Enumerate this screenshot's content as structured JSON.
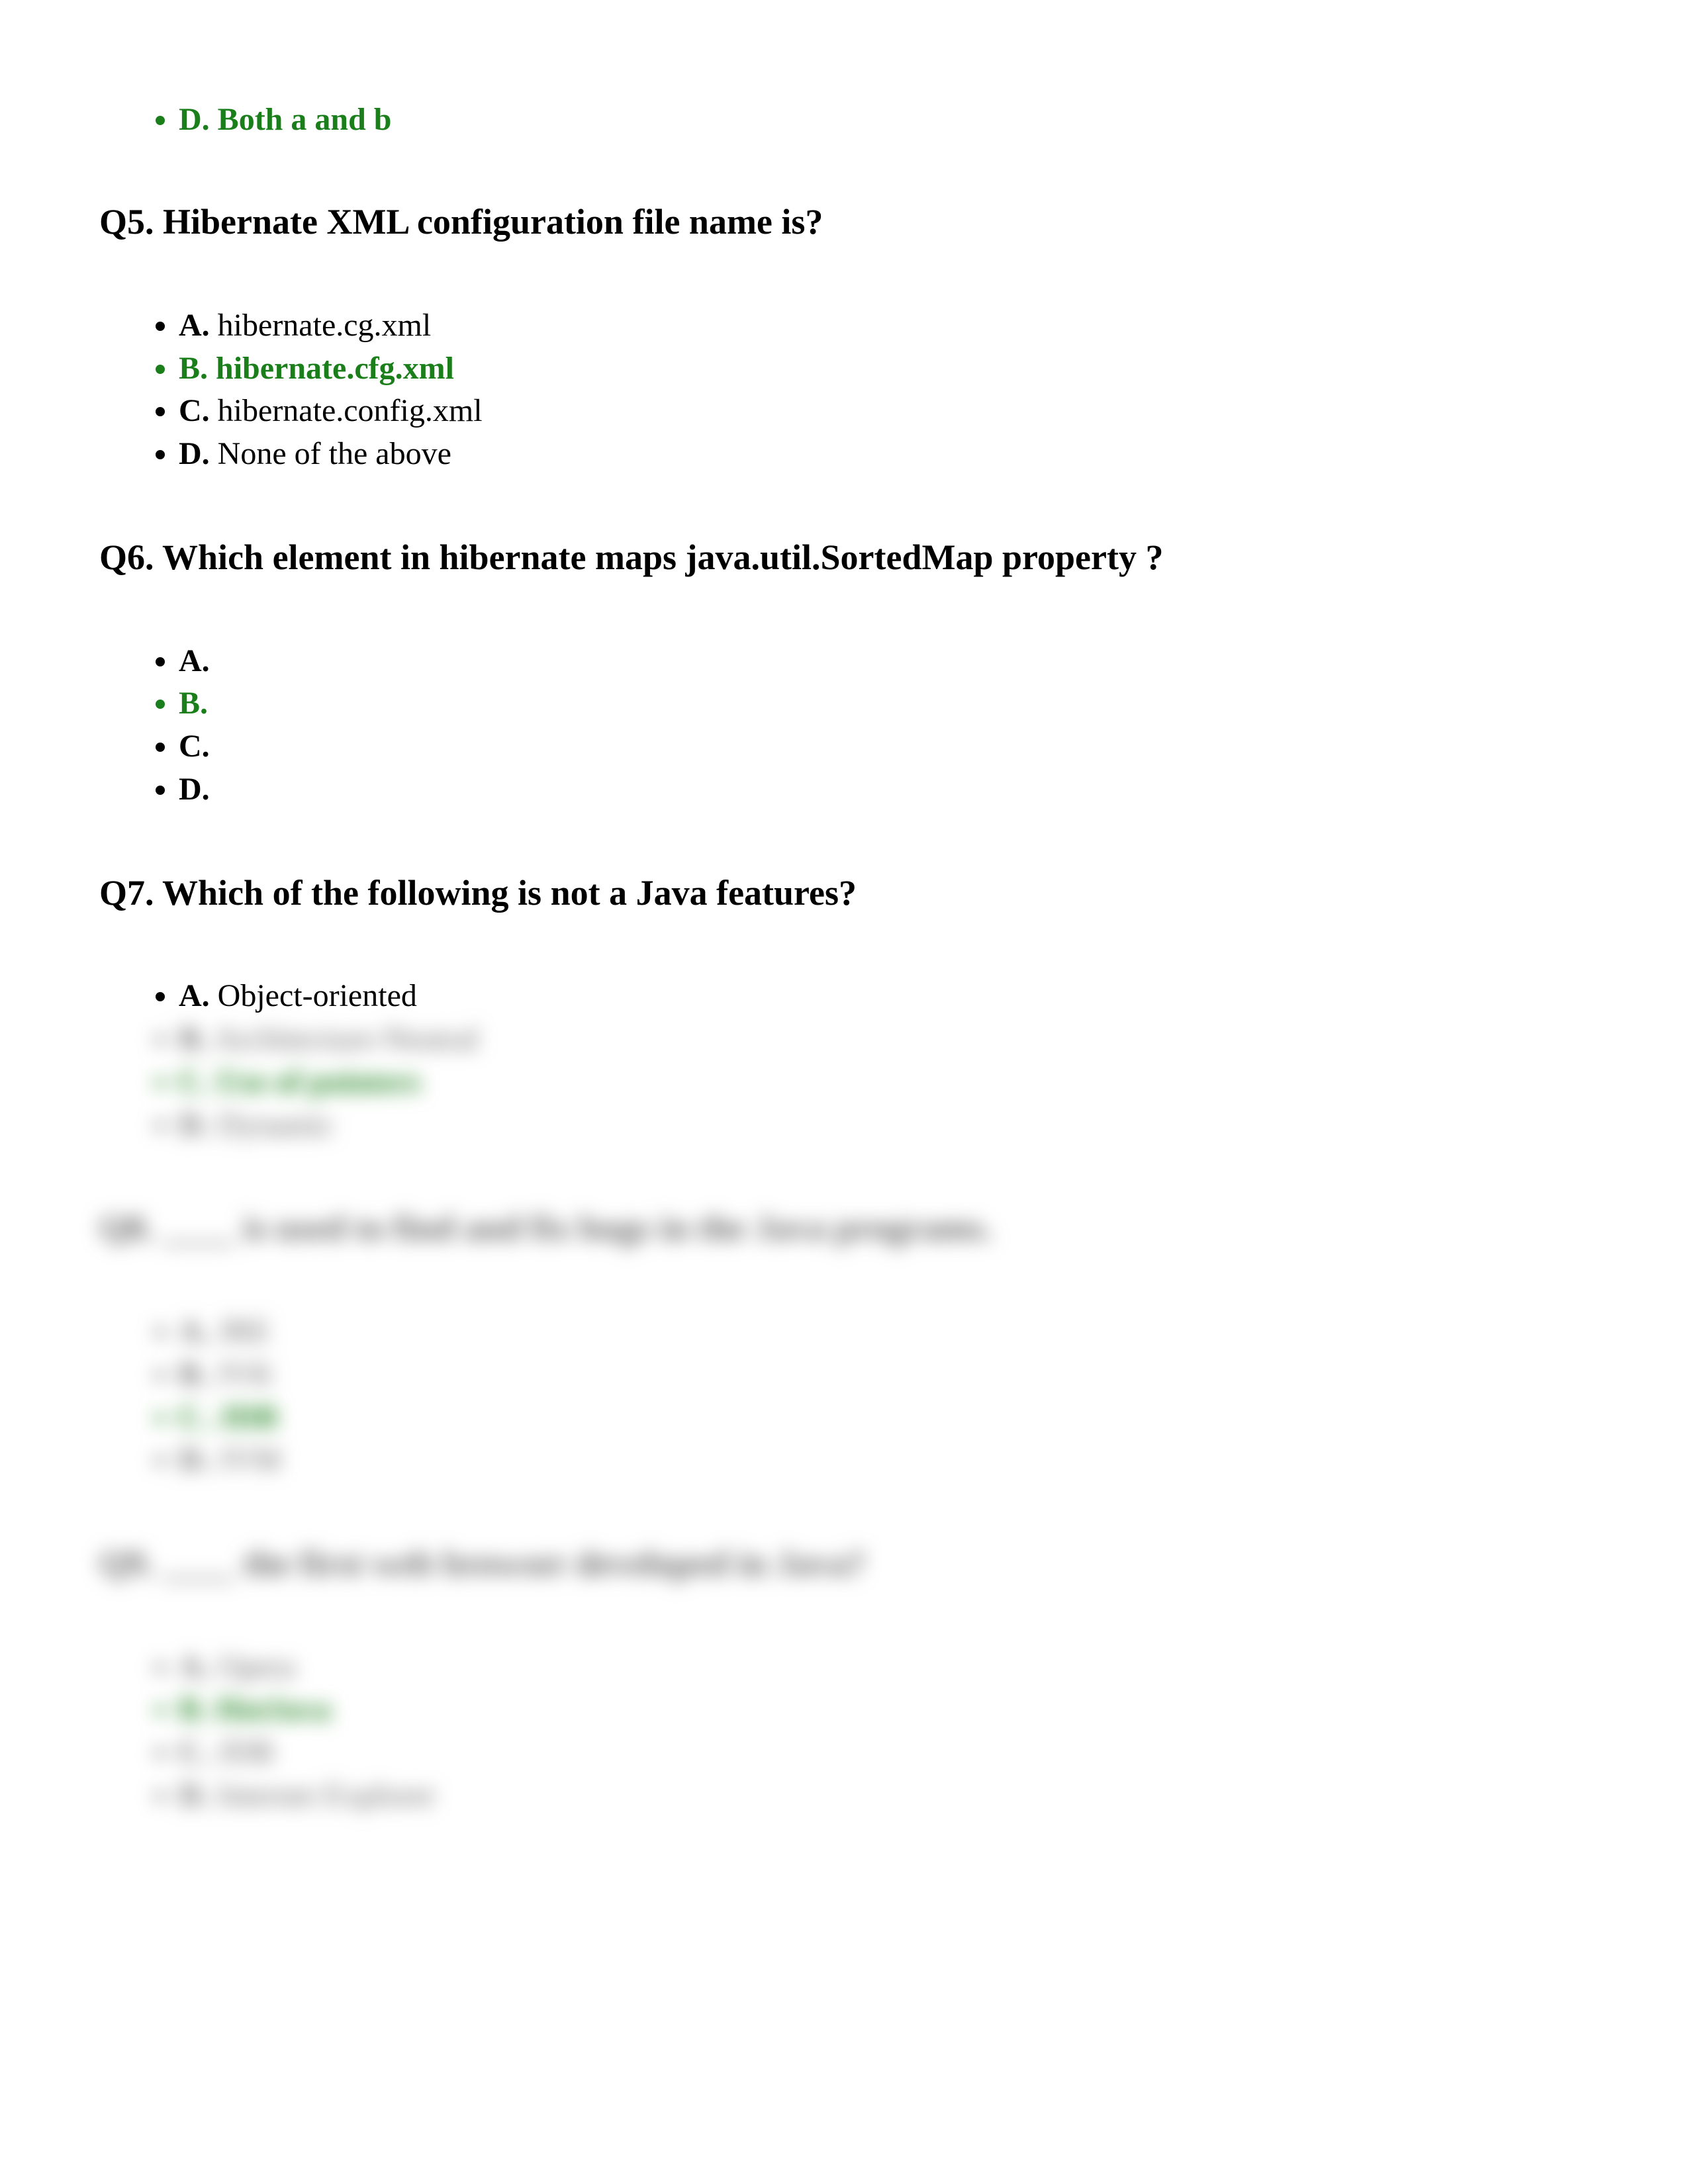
{
  "orphan_option": {
    "letter": "D.",
    "text": "Both a and b",
    "correct": true
  },
  "questions": [
    {
      "id": "q5",
      "title": "Q5. Hibernate XML configuration file name is?",
      "options": [
        {
          "letter": "A.",
          "text": " hibernate.cg.xml",
          "correct": false
        },
        {
          "letter": "B.",
          "text": "hibernate.cfg.xml",
          "correct": true
        },
        {
          "letter": "C.",
          "text": "hibernate.config.xml",
          "correct": false
        },
        {
          "letter": "D.",
          "text": "None of the above",
          "correct": false
        }
      ],
      "blurred": false
    },
    {
      "id": "q6",
      "title": "Q6. Which element in hibernate maps java.util.SortedMap property ?",
      "options": [
        {
          "letter": "A.",
          "text": "",
          "correct": false
        },
        {
          "letter": "B.",
          "text": "",
          "correct": true
        },
        {
          "letter": "C.",
          "text": "",
          "correct": false
        },
        {
          "letter": "D.",
          "text": "",
          "correct": false
        }
      ],
      "blurred": false
    },
    {
      "id": "q7",
      "title": "Q7. Which of the following is not a Java features?",
      "options": [
        {
          "letter": "A.",
          "text": " Object-oriented",
          "correct": false
        }
      ],
      "blurred_options": [
        {
          "letter": "B.",
          "text": "Architecture-Neutral",
          "correct": false
        },
        {
          "letter": "C.",
          "text": "Use of pointers",
          "correct": true
        },
        {
          "letter": "D.",
          "text": "Dynamic",
          "correct": false
        }
      ],
      "blurred": false
    },
    {
      "id": "q8",
      "title": "Q8. ____ is used to find and fix bugs in the Java programs.",
      "options": [
        {
          "letter": "A.",
          "text": " JRE",
          "correct": false
        },
        {
          "letter": "B.",
          "text": "JVK",
          "correct": false
        },
        {
          "letter": "C.",
          "text": "JDB",
          "correct": true
        },
        {
          "letter": "D.",
          "text": "JVM",
          "correct": false
        }
      ],
      "blurred": true
    },
    {
      "id": "q9",
      "title": "Q9. ____ the first web browser developed in Java?",
      "options": [
        {
          "letter": "A.",
          "text": " Opera",
          "correct": false
        },
        {
          "letter": "B.",
          "text": "HotJava",
          "correct": true
        },
        {
          "letter": "C.",
          "text": "JDB",
          "correct": false
        },
        {
          "letter": "D.",
          "text": "Internet Explorer",
          "correct": false
        }
      ],
      "blurred": true
    }
  ]
}
